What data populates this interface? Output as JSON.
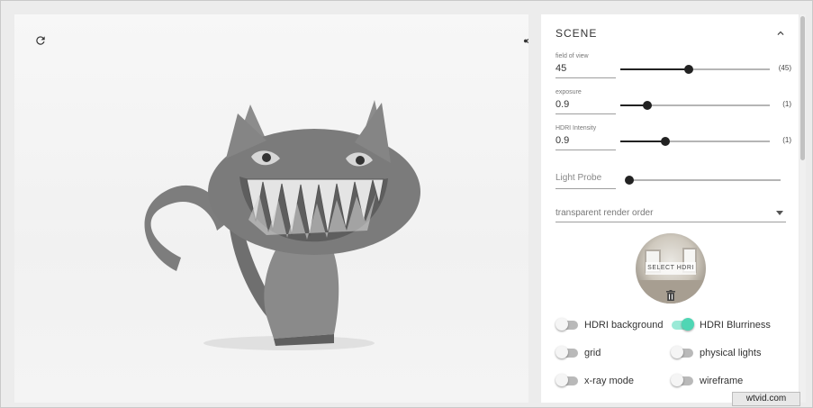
{
  "viewport": {
    "reload_icon": "reload-icon",
    "share_icon": "share-icon",
    "model": "grinning-cat-3d-model"
  },
  "panel": {
    "title": "SCENE",
    "collapse_icon": "chevron-up-icon",
    "sliders": [
      {
        "label": "field of view",
        "value": "45",
        "suffix": "(45)",
        "position": 0.46
      },
      {
        "label": "exposure",
        "value": "0.9",
        "suffix": "(1)",
        "position": 0.18
      },
      {
        "label": "HDRI Intensity",
        "value": "0.9",
        "suffix": "(1)",
        "position": 0.3
      }
    ],
    "light_probe": {
      "label": "Light Probe",
      "position": 0.0
    },
    "render_order": {
      "placeholder": "transparent render order"
    },
    "hdri": {
      "button_label": "SELECT HDRI",
      "delete_icon": "trash-icon"
    },
    "toggles": [
      {
        "label": "HDRI background",
        "on": false
      },
      {
        "label": "HDRI Blurriness",
        "on": true
      },
      {
        "label": "grid",
        "on": false
      },
      {
        "label": "physical lights",
        "on": false
      },
      {
        "label": "x-ray mode",
        "on": false
      },
      {
        "label": "wireframe",
        "on": false
      }
    ]
  },
  "watermark": "wtvid.com",
  "colors": {
    "accent": "#4fd6b4",
    "track": "#b5b5b5",
    "thumb": "#222222"
  }
}
